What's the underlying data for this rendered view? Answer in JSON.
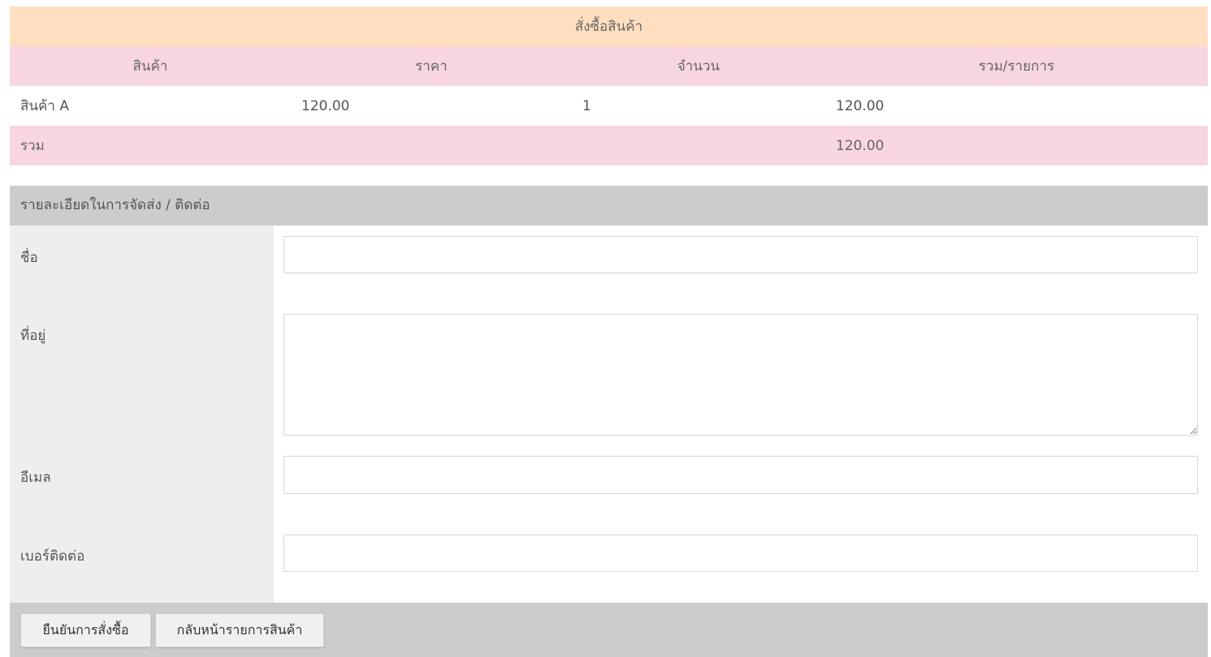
{
  "order": {
    "title": "สั่งซื้อสินค้า",
    "columns": [
      "สินค้า",
      "ราคา",
      "จำนวน",
      "รวม/รายการ"
    ],
    "items": [
      {
        "name": "สินค้า A",
        "price": "120.00",
        "qty": "1",
        "subtotal": "120.00"
      }
    ],
    "total_label": "รวม",
    "total_value": "120.00"
  },
  "shipping": {
    "header": "รายละเอียดในการจัดส่ง / ติดต่อ",
    "fields": {
      "name": {
        "label": "ชื่อ",
        "value": ""
      },
      "address": {
        "label": "ที่อยู่",
        "value": ""
      },
      "email": {
        "label": "อีเมล",
        "value": ""
      },
      "phone": {
        "label": "เบอร์ติดต่อ",
        "value": ""
      }
    }
  },
  "buttons": {
    "confirm": "ยืนยันการสั่งซื้อ",
    "back": "กลับหน้ารายการสินค้า"
  },
  "colors": {
    "title_bg": "#ffdfbf",
    "header_bg": "#f8d5e2",
    "section_bg": "#cccccc",
    "label_bg": "#eeeeee"
  }
}
